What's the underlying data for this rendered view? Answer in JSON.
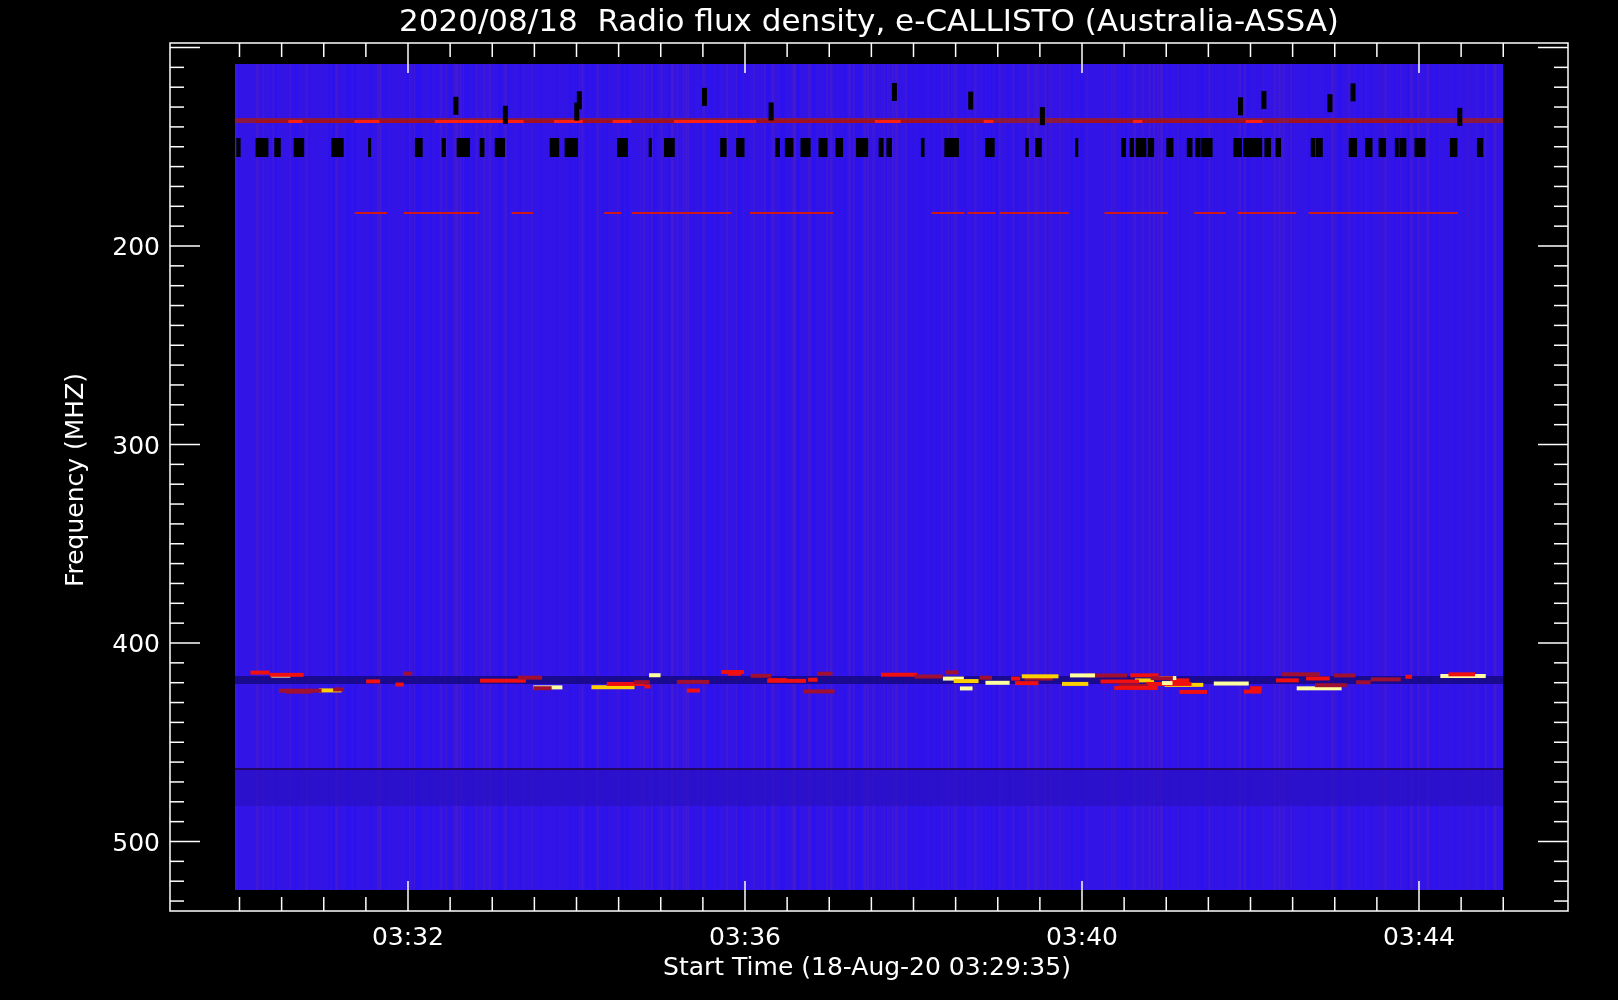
{
  "title": "2020/08/18  Radio flux density, e-CALLISTO (Australia-ASSA)",
  "y_axis": {
    "label": "Frequency (MHZ)",
    "ticks": [
      "200",
      "300",
      "400",
      "500"
    ]
  },
  "x_axis": {
    "label": "Start Time (18-Aug-20 03:29:35)",
    "ticks": [
      "03:32",
      "03:36",
      "03:40",
      "03:44"
    ]
  }
}
